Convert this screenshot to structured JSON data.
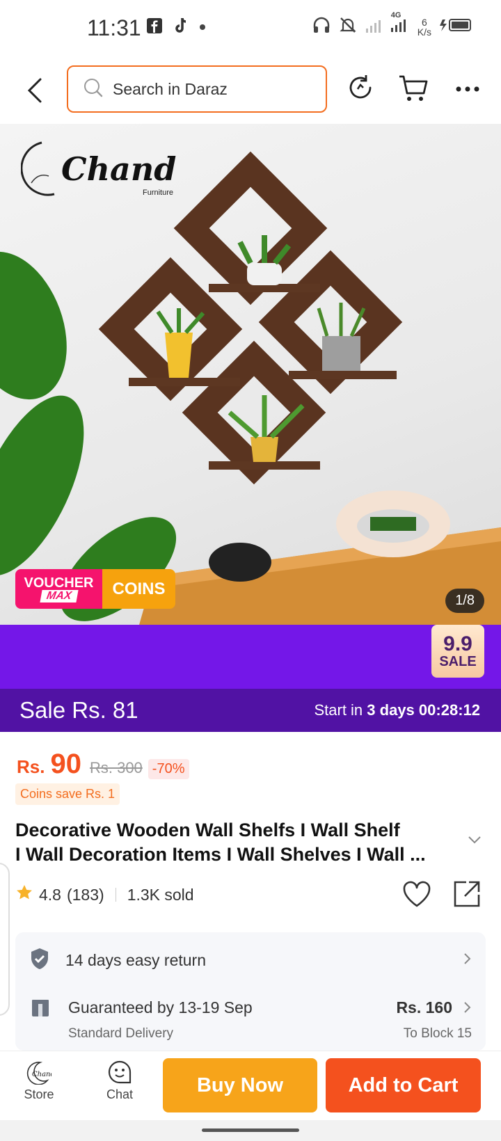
{
  "status_bar": {
    "time": "11:31",
    "network": "4G",
    "speed_value": "6",
    "speed_unit": "K/s"
  },
  "header": {
    "search_placeholder": "Search in Daraz",
    "icons": [
      "back-icon",
      "search-icon",
      "history-icon",
      "cart-icon",
      "more-icon"
    ]
  },
  "hero": {
    "brand_name": "Chand",
    "brand_sub": "Furniture",
    "voucher_line1": "VOUCHER",
    "voucher_line2": "MAX",
    "coins_label": "COINS",
    "image_counter": "1/8"
  },
  "promo": {
    "sale_badge_top": "9.9",
    "sale_badge_bottom": "SALE",
    "sale_label": "Sale",
    "sale_price": "Rs. 81",
    "start_prefix": "Start in",
    "start_days": "3 days",
    "countdown": "00:28:12"
  },
  "product": {
    "currency": "Rs.",
    "price": "90",
    "original_price": "Rs. 300",
    "discount": "-70%",
    "coins_save": "Coins save Rs. 1",
    "title_line1": "Decorative Wooden Wall Shelfs I Wall Shelf",
    "title_line2": "I Wall Decoration Items I Wall Shelves I Wall ...",
    "rating": "4.8",
    "reviews": "(183)",
    "sold": "1.3K sold"
  },
  "services": {
    "return_text": "14 days easy return",
    "delivery_text": "Guaranteed by 13-19 Sep",
    "delivery_type": "Standard Delivery",
    "delivery_fee": "Rs. 160",
    "delivery_to": "To Block 15"
  },
  "bottom_bar": {
    "store_label": "Store",
    "chat_label": "Chat",
    "buy_now": "Buy Now",
    "add_to_cart": "Add to Cart"
  },
  "colors": {
    "accent_orange": "#f4511e",
    "buy_now_yellow": "#f7a41a",
    "promo_purple": "#7417e8",
    "sale_band_purple": "#5112a4"
  }
}
